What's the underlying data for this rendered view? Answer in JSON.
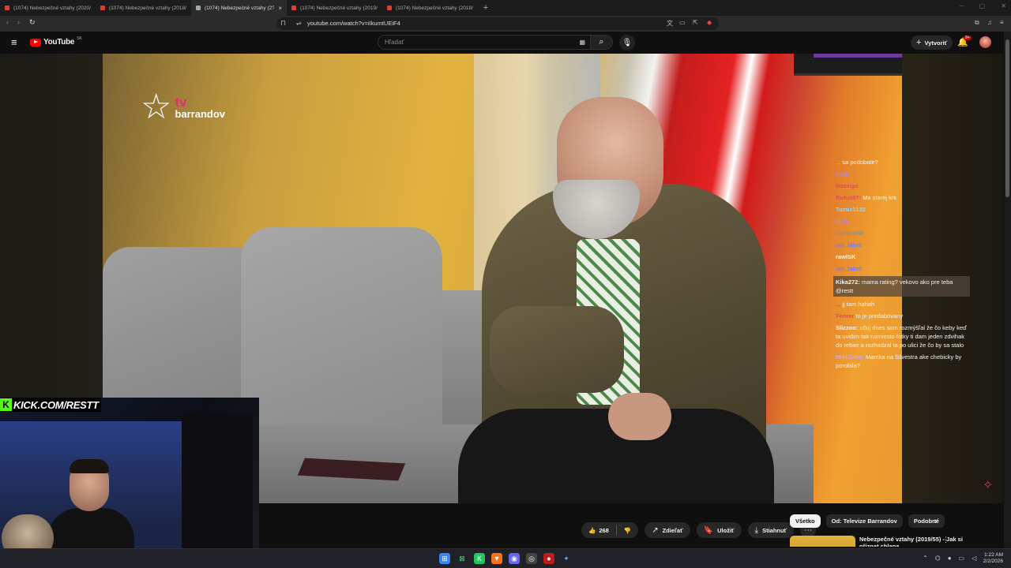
{
  "browser": {
    "tabs": [
      {
        "title": "(1074) Nebezpečné vztahy (2020/1?",
        "active": false
      },
      {
        "title": "(1074) Nebezpečné vztahy (2018/4I?",
        "active": false
      },
      {
        "title": "(1074) Nebezpečné vztahy (2?",
        "active": true
      },
      {
        "title": "(1074) Nebezpečné vztahy (2019/55?",
        "active": false
      },
      {
        "title": "(1074) Nebezpečné vztahy (2018/47?",
        "active": false
      }
    ],
    "new_tab": "+",
    "close": "×",
    "url": "youtube.com/watch?v=iIkumtUEiF4"
  },
  "youtube": {
    "logo_text": "YouTube",
    "country_code": "SK",
    "search_placeholder": "Hľadať",
    "create_label": "Vytvoriť",
    "notif_count": "9+"
  },
  "video": {
    "channel_logo_tv": "tv",
    "channel_logo_name": "barrandov",
    "overlay_url": "KICK.COM/RESTT"
  },
  "chat": [
    {
      "user": "...",
      "text": "sa podobate?",
      "color": "#e6a04d",
      "highlight": false
    },
    {
      "user": "heXn",
      "text": "",
      "color": "#b184f5",
      "highlight": false
    },
    {
      "user": "bosvigo",
      "text": "",
      "color": "#e04f4f",
      "highlight": false
    },
    {
      "user": "Rufus97:",
      "text": "Ma starej krk",
      "color": "#e04f4f",
      "highlight": false
    },
    {
      "user": "Tomix1132",
      "text": "",
      "color": "#8fd3ff",
      "highlight": false
    },
    {
      "user": "heXn",
      "text": "",
      "color": "#b184f5",
      "highlight": false
    },
    {
      "user": "loretto888",
      "text": "",
      "color": "#9b8f7a",
      "highlight": false
    },
    {
      "user": "sol_label:",
      "text": "",
      "color": "#7c7cf2",
      "highlight": false
    },
    {
      "user": "rawlSK",
      "text": "",
      "color": "#f3f3f3",
      "highlight": false
    },
    {
      "user": "sol_label:",
      "text": "",
      "color": "#7c7cf2",
      "highlight": false
    },
    {
      "user": "Kika272:",
      "text": "mama rating? vekovo ako pre teba @restt",
      "color": "#f3f3f3",
      "highlight": true
    },
    {
      "user": "...",
      "text": "jj tam hahah",
      "color": "#e04f4f",
      "highlight": false
    },
    {
      "user": "Fenrer",
      "text": "to je predabovany",
      "color": "#e04f4f",
      "highlight": false
    },
    {
      "user": "Slizzoo:",
      "text": "učuj dnes som rozmýšľal že čo keby keď ta uvidim tak namiesto fotky ti dam jeden zdvihak do rebier a rozhadzal ta po ulici že čo by sa stalo",
      "color": "#f3f3f3",
      "highlight": false
    },
    {
      "user": "MikiGabe:",
      "text": "Mamka na Silvestra ake chebicky by porobila?",
      "color": "#c9a5f5",
      "highlight": false
    }
  ],
  "actions": {
    "like_count": "268",
    "share": "Zdieľať",
    "save": "Uložiť",
    "download": "Stiahnuť",
    "more": "⋯"
  },
  "chips": [
    "Všetko",
    "Od: Televize Barrandov",
    "Podobné"
  ],
  "recommendation": {
    "title": "Nebezpečné vztahy (2019/55) - Jak si přiznat chlapa"
  },
  "taskbar": {
    "time": "1:22 AM",
    "date": "2/2/2026"
  },
  "icons": [
    "menu-icon",
    "search-icon",
    "keyboard-icon",
    "mic-icon",
    "bell-icon",
    "like-icon",
    "dislike-icon",
    "share-icon",
    "save-icon",
    "download-icon",
    "windows-start-icon"
  ]
}
